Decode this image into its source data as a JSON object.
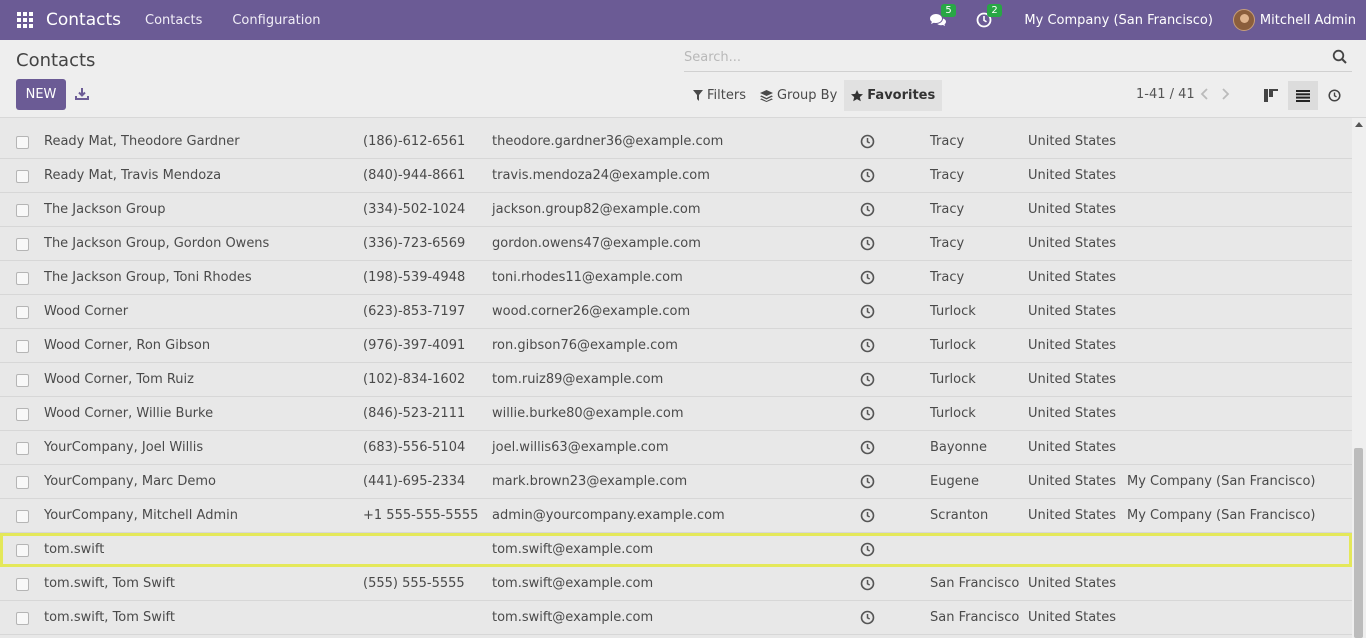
{
  "navbar": {
    "app_title": "Contacts",
    "menu": [
      "Contacts",
      "Configuration"
    ],
    "messages_count": "5",
    "activities_count": "2",
    "company": "My Company (San Francisco)",
    "user": "Mitchell Admin"
  },
  "control_panel": {
    "title": "Contacts",
    "new_label": "NEW",
    "search_placeholder": "Search...",
    "filters_label": "Filters",
    "group_by_label": "Group By",
    "favorites_label": "Favorites",
    "pager": "1-41 / 41"
  },
  "rows": [
    {
      "name": "Ready Mat, Theodore Gardner",
      "phone": "(186)-612-6561",
      "email": "theodore.gardner36@example.com",
      "city": "Tracy",
      "country": "United States",
      "company": ""
    },
    {
      "name": "Ready Mat, Travis Mendoza",
      "phone": "(840)-944-8661",
      "email": "travis.mendoza24@example.com",
      "city": "Tracy",
      "country": "United States",
      "company": ""
    },
    {
      "name": "The Jackson Group",
      "phone": "(334)-502-1024",
      "email": "jackson.group82@example.com",
      "city": "Tracy",
      "country": "United States",
      "company": ""
    },
    {
      "name": "The Jackson Group, Gordon Owens",
      "phone": "(336)-723-6569",
      "email": "gordon.owens47@example.com",
      "city": "Tracy",
      "country": "United States",
      "company": ""
    },
    {
      "name": "The Jackson Group, Toni Rhodes",
      "phone": "(198)-539-4948",
      "email": "toni.rhodes11@example.com",
      "city": "Tracy",
      "country": "United States",
      "company": ""
    },
    {
      "name": "Wood Corner",
      "phone": "(623)-853-7197",
      "email": "wood.corner26@example.com",
      "city": "Turlock",
      "country": "United States",
      "company": ""
    },
    {
      "name": "Wood Corner, Ron Gibson",
      "phone": "(976)-397-4091",
      "email": "ron.gibson76@example.com",
      "city": "Turlock",
      "country": "United States",
      "company": ""
    },
    {
      "name": "Wood Corner, Tom Ruiz",
      "phone": "(102)-834-1602",
      "email": "tom.ruiz89@example.com",
      "city": "Turlock",
      "country": "United States",
      "company": ""
    },
    {
      "name": "Wood Corner, Willie Burke",
      "phone": "(846)-523-2111",
      "email": "willie.burke80@example.com",
      "city": "Turlock",
      "country": "United States",
      "company": ""
    },
    {
      "name": "YourCompany, Joel Willis",
      "phone": "(683)-556-5104",
      "email": "joel.willis63@example.com",
      "city": "Bayonne",
      "country": "United States",
      "company": ""
    },
    {
      "name": "YourCompany, Marc Demo",
      "phone": "(441)-695-2334",
      "email": "mark.brown23@example.com",
      "city": "Eugene",
      "country": "United States",
      "company": "My Company (San Francisco)"
    },
    {
      "name": "YourCompany, Mitchell Admin",
      "phone": "+1 555-555-5555",
      "email": "admin@yourcompany.example.com",
      "city": "Scranton",
      "country": "United States",
      "company": "My Company (San Francisco)"
    },
    {
      "name": "tom.swift",
      "phone": "",
      "email": "tom.swift@example.com",
      "city": "",
      "country": "",
      "company": ""
    },
    {
      "name": "tom.swift, Tom Swift",
      "phone": "(555) 555-5555",
      "email": "tom.swift@example.com",
      "city": "San Francisco",
      "country": "United States",
      "company": ""
    },
    {
      "name": "tom.swift, Tom Swift",
      "phone": "",
      "email": "tom.swift@example.com",
      "city": "San Francisco",
      "country": "United States",
      "company": ""
    }
  ],
  "selected_row_index": 12
}
